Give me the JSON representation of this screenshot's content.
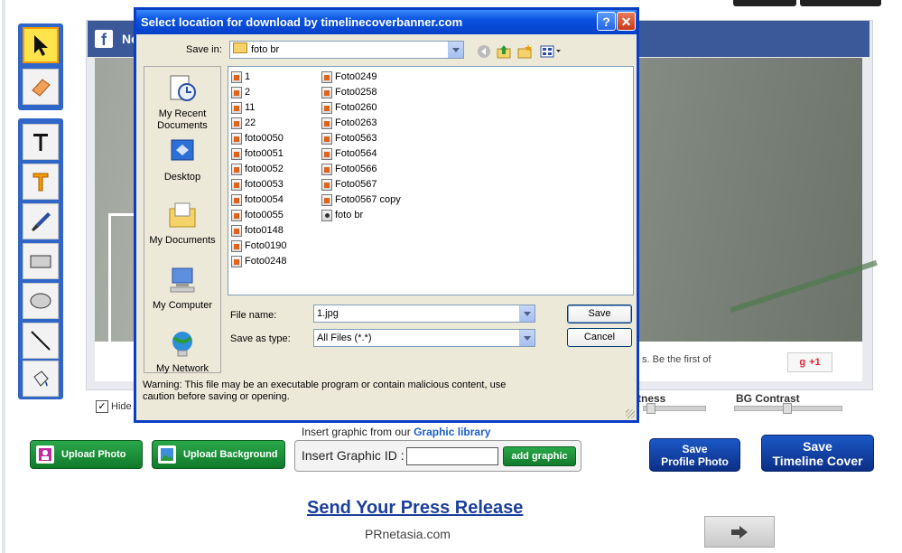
{
  "dialog": {
    "title": "Select location for download by timelinecoverbanner.com",
    "help_btn": "?",
    "close_btn": "✕",
    "save_in_label": "Save in:",
    "save_in_value": "foto br",
    "places": [
      "My Recent Documents",
      "Desktop",
      "My Documents",
      "My Computer",
      "My Network"
    ],
    "files_col1": [
      "1",
      "2",
      "11",
      "22",
      "foto0050",
      "foto0051",
      "foto0052",
      "foto0053",
      "foto0054",
      "foto0055",
      "foto0148",
      "Foto0190",
      "Foto0248"
    ],
    "files_col2": [
      "Foto0249",
      "Foto0258",
      "Foto0260",
      "Foto0263",
      "Foto0563",
      "Foto0564",
      "Foto0566",
      "Foto0567",
      "Foto0567 copy",
      "foto br"
    ],
    "file_name_label": "File name:",
    "file_name_value": "1.jpg",
    "save_as_label": "Save as type:",
    "save_as_value": "All Files (*.*)",
    "save_btn": "Save",
    "cancel_btn": "Cancel",
    "warning": "Warning: This file may be an executable program or contain malicious content, use caution before saving or opening."
  },
  "page": {
    "fb_name": "Ne",
    "fb_text": "s. Be the first of",
    "gplus": "+1",
    "hide_label": "Hide",
    "brightness_label": "tness",
    "bg_contrast_label": "BG Contrast",
    "upload_photo": "Upload  Photo",
    "upload_background": "Upload Background",
    "insert_prefix": "Insert graphic from our ",
    "insert_link": "Graphic library",
    "insert_id_label": "Insert Graphic ID :",
    "add_graphic": "add graphic",
    "save_profile_1": "Save",
    "save_profile_2": "Profile Photo",
    "save_timeline_1": "Save",
    "save_timeline_2": "Timeline Cover",
    "press_release": "Send Your Press Release",
    "prnetasia": "PRnetasia.com"
  },
  "colors": {
    "accent": "#0a52e0",
    "toolbar": "#2f66c7",
    "green": "#117a2c",
    "blue": "#0c2f86"
  }
}
